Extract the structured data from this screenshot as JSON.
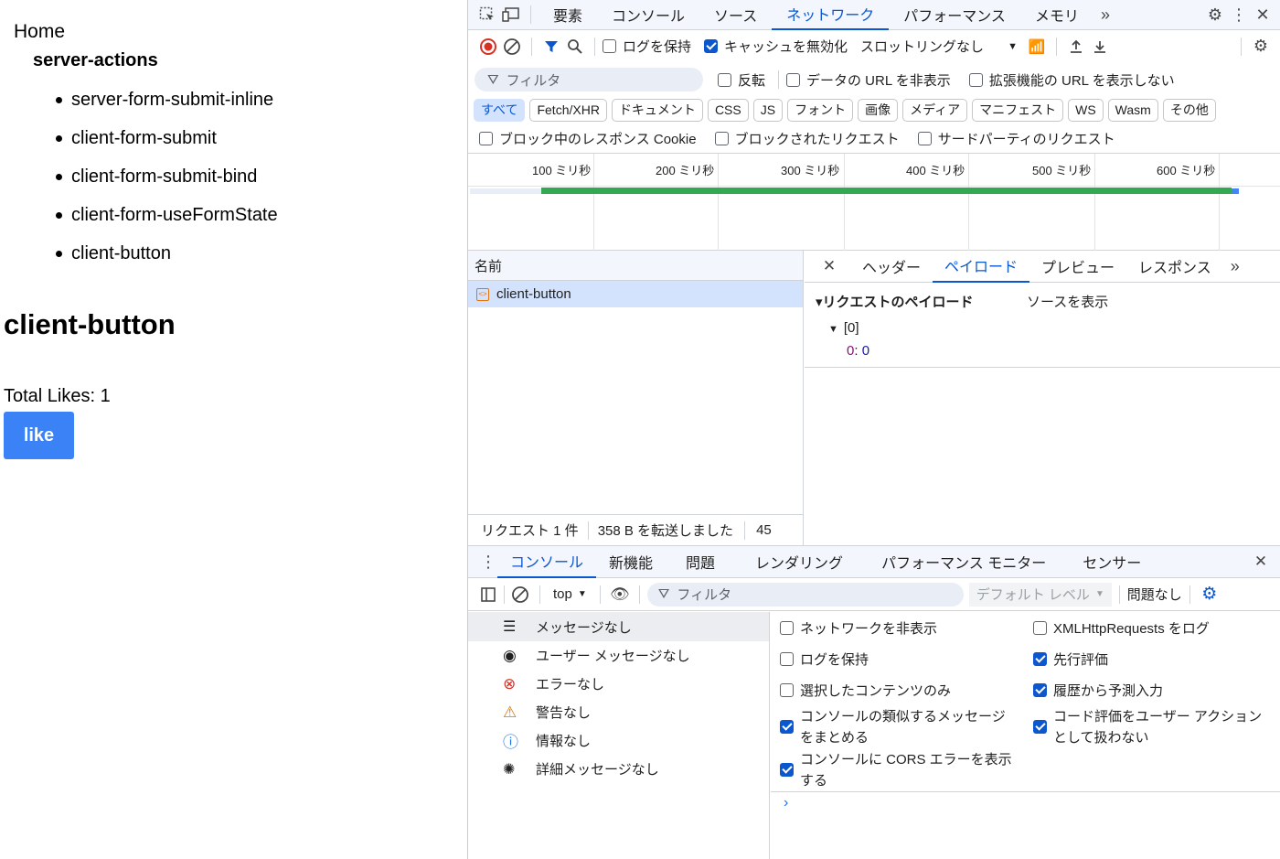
{
  "page": {
    "home": "Home",
    "section": "server-actions",
    "links": [
      "server-form-submit-inline",
      "client-form-submit",
      "client-form-submit-bind",
      "client-form-useFormState",
      "client-button"
    ],
    "heading": "client-button",
    "likes": "Total Likes: 1",
    "like_button": "like",
    "accent": "#3b82f6"
  },
  "devtools": {
    "main_tabs": [
      "要素",
      "コンソール",
      "ソース",
      "ネットワーク",
      "パフォーマンス",
      "メモリ"
    ],
    "active_tab": "ネットワーク",
    "toolbar": {
      "preserve_log": "ログを保持",
      "disable_cache": "キャッシュを無効化",
      "throttle": "スロットリングなし"
    },
    "filter": {
      "placeholder": "フィルタ",
      "invert": "反転",
      "hide_data": "データの URL を非表示",
      "hide_ext": "拡張機能の URL を表示しない"
    },
    "types": [
      "すべて",
      "Fetch/XHR",
      "ドキュメント",
      "CSS",
      "JS",
      "フォント",
      "画像",
      "メディア",
      "マニフェスト",
      "WS",
      "Wasm",
      "その他"
    ],
    "blocked": {
      "cookies": "ブロック中のレスポンス Cookie",
      "requests": "ブロックされたリクエスト",
      "third_party": "サードパーティのリクエスト"
    },
    "timeline_ticks": [
      "100 ミリ秒",
      "200 ミリ秒",
      "300 ミリ秒",
      "400 ミリ秒",
      "500 ミリ秒",
      "600 ミリ秒"
    ],
    "list": {
      "header": "名前",
      "rows": [
        "client-button"
      ]
    },
    "status": {
      "count": "リクエスト 1 件",
      "transferred": "358 B を転送しました",
      "extra": "45"
    },
    "detail": {
      "tabs": [
        "ヘッダー",
        "ペイロード",
        "プレビュー",
        "レスポンス"
      ],
      "active": "ペイロード",
      "section": "リクエストのペイロード",
      "view_source": "ソースを表示",
      "array": "[0]",
      "key": "0",
      "value": "0"
    },
    "drawer": {
      "tabs": [
        "コンソール",
        "新機能",
        "問題",
        "レンダリング",
        "パフォーマンス モニター",
        "センサー"
      ],
      "active": "コンソール",
      "context": "top",
      "filter": "フィルタ",
      "level": "デフォルト レベル",
      "issues": "問題なし"
    },
    "sidebar": [
      "メッセージなし",
      "ユーザー メッセージなし",
      "エラーなし",
      "警告なし",
      "情報なし",
      "詳細メッセージなし"
    ],
    "settings_left": [
      {
        "label": "ネットワークを非表示",
        "checked": false
      },
      {
        "label": "ログを保持",
        "checked": false
      },
      {
        "label": "選択したコンテンツのみ",
        "checked": false
      },
      {
        "label": "コンソールの類似するメッセージをまとめる",
        "checked": true
      },
      {
        "label": "コンソールに CORS エラーを表示する",
        "checked": true
      }
    ],
    "settings_right": [
      {
        "label": "XMLHttpRequests をログ",
        "checked": false
      },
      {
        "label": "先行評価",
        "checked": true
      },
      {
        "label": "履歴から予測入力",
        "checked": true
      },
      {
        "label": "コード評価をユーザー アクションとして扱わない",
        "checked": true
      }
    ],
    "prompt": "›"
  }
}
